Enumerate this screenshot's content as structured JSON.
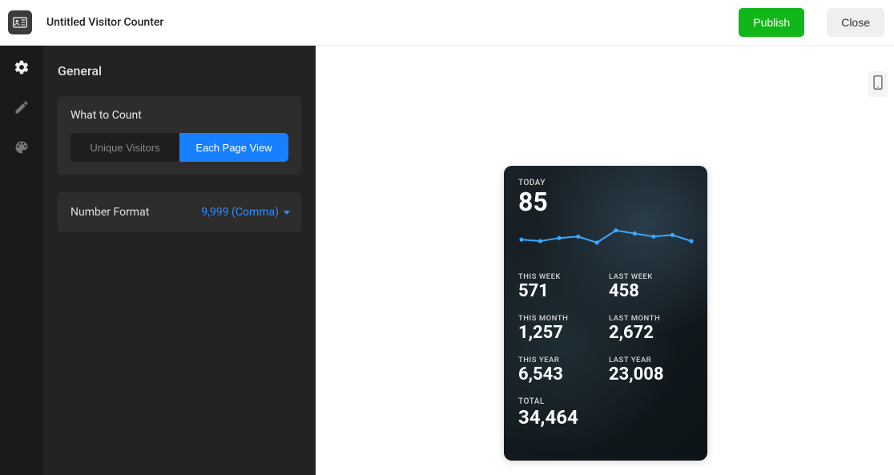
{
  "header": {
    "title": "Untitled Visitor Counter",
    "publish_label": "Publish",
    "close_label": "Close"
  },
  "panel": {
    "title": "General",
    "what_to_count": {
      "label": "What to Count",
      "options": {
        "unique": "Unique Visitors",
        "each": "Each Page View"
      },
      "selected": "each"
    },
    "number_format": {
      "label": "Number Format",
      "value": "9,999 (Comma)"
    }
  },
  "widget": {
    "today_label": "TODAY",
    "today_value": "85",
    "stats": [
      {
        "label": "THIS WEEK",
        "value": "571"
      },
      {
        "label": "LAST WEEK",
        "value": "458"
      },
      {
        "label": "THIS MONTH",
        "value": "1,257"
      },
      {
        "label": "LAST MONTH",
        "value": "2,672"
      },
      {
        "label": "THIS YEAR",
        "value": "6,543"
      },
      {
        "label": "LAST YEAR",
        "value": "23,008"
      }
    ],
    "total_label": "TOTAL",
    "total_value": "34,464"
  },
  "chart_data": {
    "type": "line",
    "title": "",
    "xlabel": "",
    "ylabel": "",
    "x": [
      0,
      1,
      2,
      3,
      4,
      5,
      6,
      7,
      8,
      9
    ],
    "values": [
      22,
      20,
      24,
      26,
      18,
      34,
      30,
      26,
      28,
      20
    ],
    "ylim": [
      0,
      40
    ]
  }
}
